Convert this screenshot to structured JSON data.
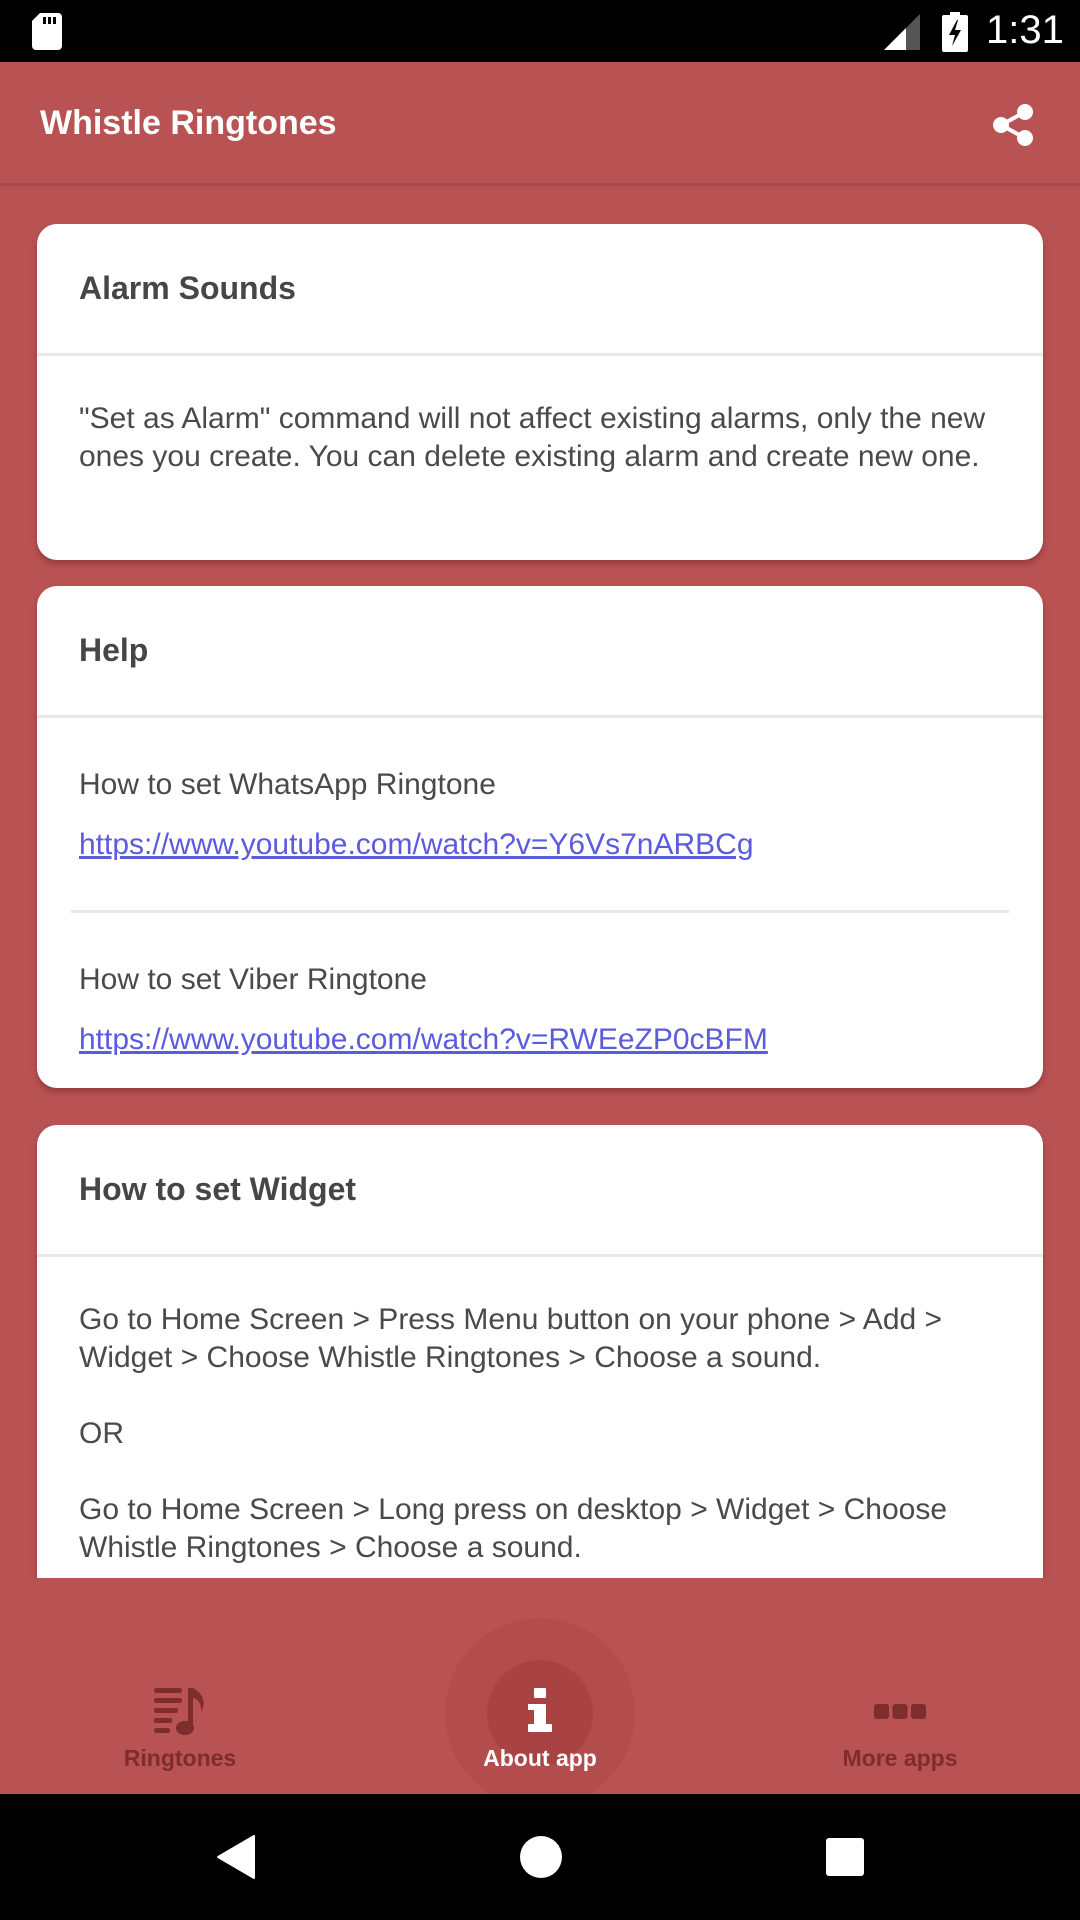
{
  "status_bar": {
    "time": "1:31",
    "icons": [
      "sd-card-icon",
      "signal-icon",
      "battery-charging-icon"
    ]
  },
  "app_bar": {
    "title": "Whistle Ringtones",
    "action_icon": "share-icon"
  },
  "cards": {
    "alarm": {
      "title": "Alarm Sounds",
      "body": "\"Set as Alarm\" command will not affect existing alarms, only the new ones you create. You can delete existing alarm and create new one."
    },
    "help": {
      "title": "Help",
      "items": [
        {
          "label": "How to set WhatsApp Ringtone",
          "link": "https://www.youtube.com/watch?v=Y6Vs7nARBCg"
        },
        {
          "label": "How to set Viber Ringtone",
          "link": "https://www.youtube.com/watch?v=RWEeZP0cBFM"
        }
      ]
    },
    "widget": {
      "title": "How to set Widget",
      "paragraphs": [
        "Go to Home Screen > Press Menu button on your phone > Add > Widget > Choose Whistle Ringtones > Choose a sound.",
        "OR",
        "Go to Home Screen > Long press on desktop > Widget > Choose Whistle Ringtones > Choose a sound."
      ]
    }
  },
  "bottom_nav": {
    "items": [
      {
        "label": "Ringtones",
        "icon": "music-list-icon",
        "active": false
      },
      {
        "label": "About app",
        "icon": "info-icon",
        "active": true
      },
      {
        "label": "More apps",
        "icon": "more-dots-icon",
        "active": false
      }
    ]
  },
  "system_nav": {
    "buttons": [
      "back",
      "home",
      "recents"
    ]
  },
  "colors": {
    "primary": "#b95252",
    "nav_inactive": "#7e2d2d",
    "link": "#5b5bdf",
    "card_bg": "#ffffff",
    "text": "#4a4a4a"
  }
}
